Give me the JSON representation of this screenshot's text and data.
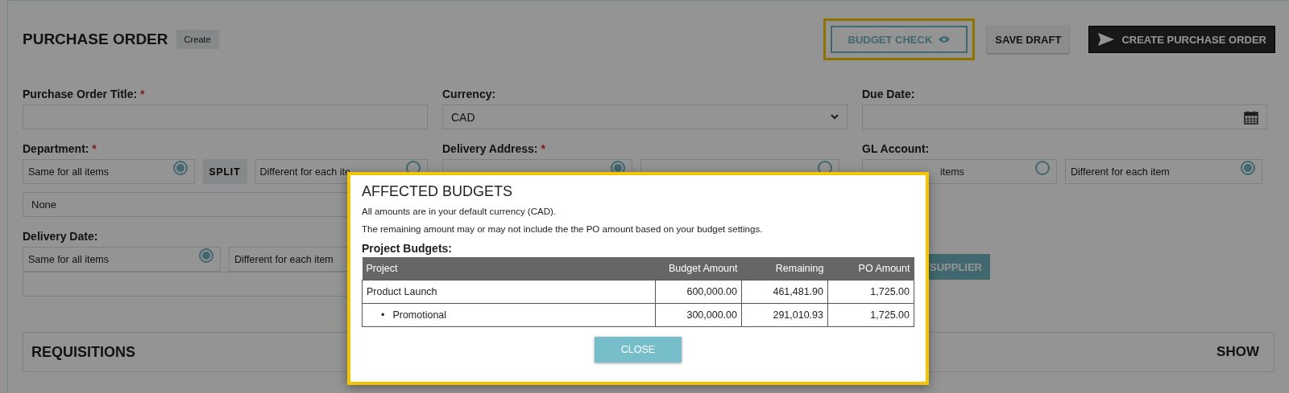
{
  "header": {
    "title": "PURCHASE ORDER",
    "badge": "Create"
  },
  "actions": [
    {
      "label": "BUDGET CHECK",
      "kind": "outline",
      "highlighted": true
    },
    {
      "label": "SAVE DRAFT",
      "kind": "light"
    },
    {
      "label": "CREATE PURCHASE ORDER",
      "kind": "dark"
    }
  ],
  "title_field": {
    "label": "Purchase Order Title:",
    "required_mark": "*"
  },
  "currency": {
    "label": "Currency:",
    "value": "CAD"
  },
  "due_date": {
    "label": "Due Date:"
  },
  "department": {
    "label": "Department:",
    "required_mark": "*",
    "split": "SPLIT",
    "options": [
      {
        "label": "Same for all items",
        "selected": true
      },
      {
        "label": "Different for each ite",
        "selected": false
      }
    ],
    "value": "None"
  },
  "delivery_address": {
    "label": "Delivery Address:",
    "required_mark": "*",
    "options": [
      {
        "selected": true
      },
      {
        "selected": false
      }
    ]
  },
  "gl_account": {
    "label": "GL Account:",
    "options": [
      {
        "label": "items",
        "selected": false
      },
      {
        "label": "Different for each item",
        "selected": true
      }
    ]
  },
  "delivery_date": {
    "label": "Delivery Date:",
    "options": [
      {
        "label": "Same for all items",
        "selected": true
      },
      {
        "label": "Different for each item"
      }
    ]
  },
  "supplier_button": "SUPPLIER",
  "requisitions": {
    "title": "REQUISITIONS",
    "toggle": "SHOW"
  },
  "modal": {
    "title": "AFFECTED BUDGETS",
    "notes": [
      "All amounts are in your default currency (CAD).",
      "The remaining amount may or may not include the the PO amount based on your budget settings."
    ],
    "section": "Project Budgets:",
    "columns": [
      "Project",
      "Budget Amount",
      "Remaining",
      "PO Amount"
    ],
    "rows": [
      {
        "cells": [
          "Product Launch",
          "600,000.00",
          "461,481.90",
          "1,725.00"
        ],
        "children": [
          {
            "bullet": "•",
            "cells": [
              "Promotional",
              "300,000.00",
              "291,010.93",
              "1,725.00"
            ]
          }
        ]
      }
    ],
    "close": "CLOSE"
  }
}
